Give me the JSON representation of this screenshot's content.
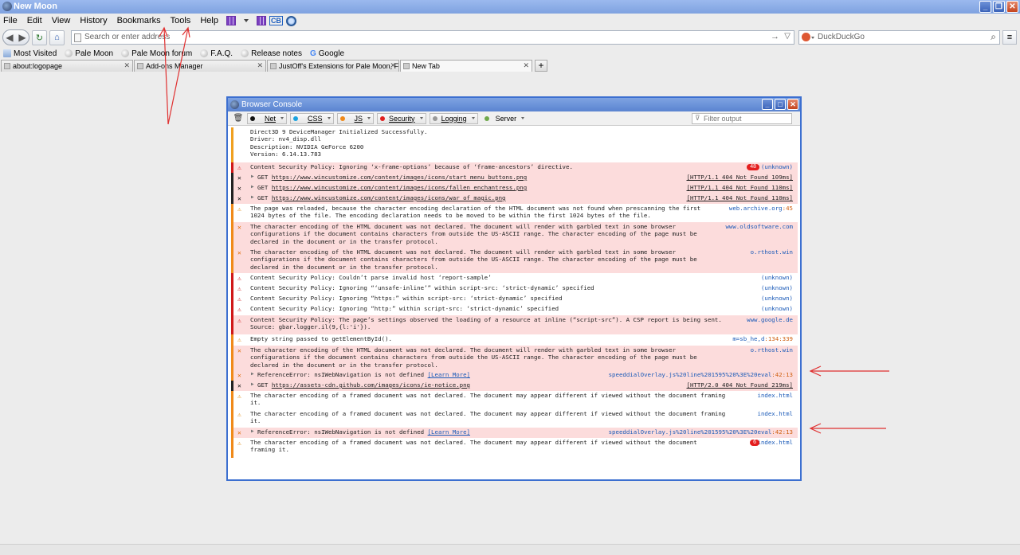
{
  "window": {
    "title": "New Moon"
  },
  "menubar": {
    "items": [
      "File",
      "Edit",
      "View",
      "History",
      "Bookmarks",
      "Tools",
      "Help"
    ]
  },
  "toolbar_icons": [
    "grid-extension-icon",
    "dropdown-arrow-icon",
    "grid-extension-icon-2",
    "cb-icon",
    "globe-icon"
  ],
  "navbar": {
    "url_placeholder": "Search or enter address",
    "search_engine": "DuckDuckGo"
  },
  "bookmarks": [
    "Most Visited",
    "Pale Moon",
    "Pale Moon forum",
    "F.A.Q.",
    "Release notes",
    "Google"
  ],
  "tabs": [
    {
      "label": "about:logopage",
      "active": false
    },
    {
      "label": "Add-ons Manager",
      "active": false
    },
    {
      "label": "JustOff's Extensions for Pale Moon, Firefo",
      "active": false
    },
    {
      "label": "New Tab",
      "active": true
    }
  ],
  "console": {
    "title": "Browser Console",
    "filters": [
      "Net",
      "CSS",
      "JS",
      "Security",
      "Logging",
      "Server"
    ],
    "filter_colors": {
      "Net": "#111111",
      "CSS": "#1aa3e0",
      "JS": "#f08a1a",
      "Security": "#e02020",
      "Logging": "#999999",
      "Server": "#6fa84c"
    },
    "filter_placeholder": "Filter output",
    "entries": [
      {
        "type": "info",
        "severity": "warn",
        "text": "Direct3D 9 DeviceManager Initialized Successfully.\nDriver: nv4_disp.dll\nDescription: NVIDIA GeForce 6200\nVersion: 6.14.13.783",
        "loc": ""
      },
      {
        "type": "security",
        "severity": "error",
        "text": "Content Security Policy: Ignoring ‘x-frame-options’ because of ‘frame-ancestors’ directive.",
        "loc": "(unknown)",
        "repeat": "48"
      },
      {
        "type": "net",
        "severity": "x",
        "method": "GET",
        "url": "https://www.wincustomize.com/content/images/icons/start_menu_buttons.png",
        "status": "[HTTP/1.1 404 Not Found 109ms]"
      },
      {
        "type": "net",
        "severity": "x",
        "method": "GET",
        "url": "https://www.wincustomize.com/content/images/icons/fallen_enchantress.png",
        "status": "[HTTP/1.1 404 Not Found 110ms]"
      },
      {
        "type": "net",
        "severity": "x",
        "method": "GET",
        "url": "https://www.wincustomize.com/content/images/icons/war_of_magic.png",
        "status": "[HTTP/1.1 404 Not Found 110ms]"
      },
      {
        "type": "html",
        "severity": "warn",
        "text": "The page was reloaded, because the character encoding declaration of the HTML document was not found when prescanning the first\n1024 bytes of the file. The encoding declaration needs to be moved to be within the first 1024 bytes of the file.",
        "loc": "web.archive.org",
        "line": ":45"
      },
      {
        "type": "html",
        "severity": "error",
        "text": "The character encoding of the HTML document was not declared. The document will render with garbled text in some browser\nconfigurations if the document contains characters from outside the US-ASCII range. The character encoding of the page must be\ndeclared in the document or in the transfer protocol.",
        "loc": "www.oldsoftware.com"
      },
      {
        "type": "html",
        "severity": "error",
        "text": "The character encoding of the HTML document was not declared. The document will render with garbled text in some browser\nconfigurations if the document contains characters from outside the US-ASCII range. The character encoding of the page must be\ndeclared in the document or in the transfer protocol.",
        "loc": "o.rthost.win"
      },
      {
        "type": "security",
        "severity": "warn",
        "text": "Content Security Policy: Couldn’t parse invalid host ‘report-sample’",
        "loc": "(unknown)"
      },
      {
        "type": "security",
        "severity": "warn",
        "text": "Content Security Policy: Ignoring “‘unsafe-inline’” within script-src: ‘strict-dynamic’ specified",
        "loc": "(unknown)"
      },
      {
        "type": "security",
        "severity": "warn",
        "text": "Content Security Policy: Ignoring “https:” within script-src: ‘strict-dynamic’ specified",
        "loc": "(unknown)"
      },
      {
        "type": "security",
        "severity": "warn",
        "text": "Content Security Policy: Ignoring “http:” within script-src: ‘strict-dynamic’ specified",
        "loc": "(unknown)"
      },
      {
        "type": "security",
        "severity": "error",
        "text": "Content Security Policy: The page’s settings observed the loading of a resource at inline (“script-src”). A CSP report is being sent.\nSource: gbar.logger.il(9,{l:'i'}).",
        "loc": "www.google.de"
      },
      {
        "type": "js",
        "severity": "warn",
        "text": "Empty string passed to getElementById().",
        "loc": "m=sb_he,d",
        "line": ":134:339"
      },
      {
        "type": "html",
        "severity": "error",
        "text": "The character encoding of the HTML document was not declared. The document will render with garbled text in some browser\nconfigurations if the document contains characters from outside the US-ASCII range. The character encoding of the page must be\ndeclared in the document or in the transfer protocol.",
        "loc": "o.rthost.win"
      },
      {
        "type": "js",
        "severity": "x",
        "text": "ReferenceError: nsIWebNavigation is not defined",
        "learn": "[Learn More]",
        "loc": "speeddialOverlay.js%20line%201595%20%3E%20eval",
        "line": ":42:13"
      },
      {
        "type": "net",
        "severity": "x",
        "method": "GET",
        "url": "https://assets-cdn.github.com/images/icons/ie-notice.png",
        "status": "[HTTP/2.0 404 Not Found 219ms]"
      },
      {
        "type": "html",
        "severity": "warn",
        "text": "The character encoding of a framed document was not declared. The document may appear different if viewed without the document framing\nit.",
        "loc": "index.html"
      },
      {
        "type": "html",
        "severity": "warn",
        "text": "The character encoding of a framed document was not declared. The document may appear different if viewed without the document framing\nit.",
        "loc": "index.html"
      },
      {
        "type": "js",
        "severity": "x",
        "text": "ReferenceError: nsIWebNavigation is not defined",
        "learn": "[Learn More]",
        "loc": "speeddialOverlay.js%20line%201595%20%3E%20eval",
        "line": ":42:13"
      },
      {
        "type": "html",
        "severity": "warn",
        "text": "The character encoding of a framed document was not declared. The document may appear different if viewed without the document\nframing it.",
        "loc": "index.html",
        "repeat": "6"
      }
    ]
  }
}
